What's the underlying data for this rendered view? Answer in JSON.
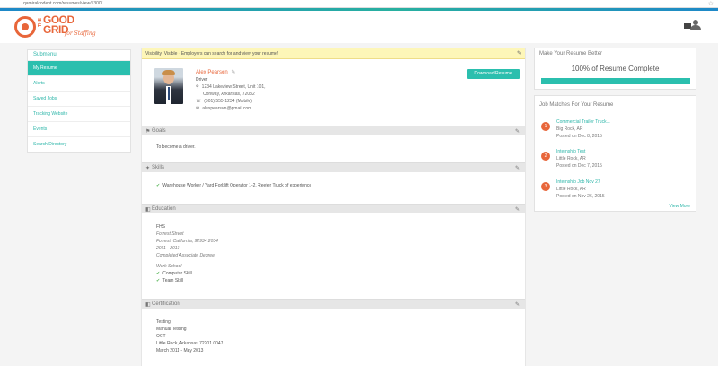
{
  "browser": {
    "url": "qamiralcodent.com/resumes/view/1300/",
    "star": "☆"
  },
  "logo": {
    "the": "THE",
    "good": "GOOD",
    "grid": "GRID",
    "tag": "for Staffing"
  },
  "sidebar": {
    "title": "Submenu",
    "items": [
      {
        "label": "My Resume",
        "active": true
      },
      {
        "label": "Alerts"
      },
      {
        "label": "Saved Jobs"
      },
      {
        "label": "Tracking Website"
      },
      {
        "label": "Events"
      },
      {
        "label": "Search Directory"
      }
    ]
  },
  "notice": {
    "text": "Visibility: Visible - Employers can search for and view your resume!",
    "edit": "✎"
  },
  "profile": {
    "name": "Alex Pearson",
    "edit": "✎",
    "title": "Driver",
    "address1": "1234 Lakeview Street, Unit 101,",
    "address2": "Conway, Arkansas, 72032",
    "phone": "(501) 555-1234 (Mobile)",
    "email": "alexpearson@gmail.com",
    "download_label": "Download Resume",
    "icons": {
      "pin": "⚲",
      "phone": "☏",
      "mail": "✉"
    }
  },
  "sections": {
    "goals": {
      "label": "Goals",
      "icon": "⚑",
      "edit": "✎",
      "text": "To become a driver."
    },
    "skills": {
      "label": "Skills",
      "icon": "✦",
      "edit": "✎",
      "items": [
        "Warehouse Worker / Yard Forklift Operator 1-2, Reefer Truck of experience"
      ]
    },
    "education": {
      "label": "Education",
      "icon": "◧",
      "edit": "✎",
      "school": "FHS",
      "street": "Forrest Street",
      "city": "Forrest, California, 92934 2034",
      "years": "2011 - 2013",
      "status": "Completed Associate Degree",
      "subtitle": "Work School",
      "checks": [
        "Computer Skill",
        "Team Skill"
      ]
    },
    "certification": {
      "label": "Certification",
      "icon": "◧",
      "edit": "✎",
      "name": "Testing",
      "type": "Manual Testing",
      "org": "OCT",
      "location": "Little Rock, Arkansas 72201 0047",
      "dates": "March 2011 - May 2013"
    }
  },
  "completion": {
    "title": "Make Your Resume Better",
    "text": "100% of Resume Complete",
    "percent": 100
  },
  "matches": {
    "title": "Job Matches For Your Resume",
    "jobs": [
      {
        "num": "1",
        "title": "Commercial Trailer Truck...",
        "location": "Big Rock, AR",
        "date": "Posted on Dec 8, 2015"
      },
      {
        "num": "2",
        "title": "Internship Test",
        "location": "Little Rock, AR",
        "date": "Posted on Dec 7, 2015"
      },
      {
        "num": "3",
        "title": "Internship Job Nov 27",
        "location": "Little Rock, AR",
        "date": "Posted on Nov 26, 2015"
      }
    ],
    "view_more": "View More"
  },
  "colors": {
    "accent": "#2bbfae",
    "brand": "#e8663a",
    "notice_bg": "#fdf6b8"
  }
}
